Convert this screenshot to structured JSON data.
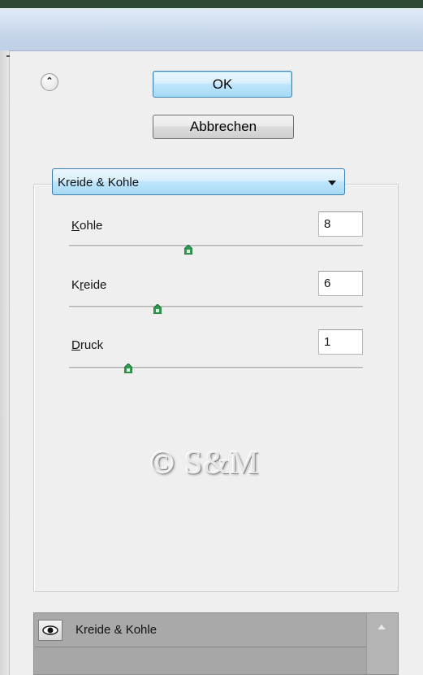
{
  "dialog": {
    "ok_label": "OK",
    "cancel_label": "Abbrechen",
    "collapse_icon": "double-chevron-up-icon"
  },
  "filter": {
    "selected": "Kreide & Kohle",
    "parameters": [
      {
        "label": "Kohle",
        "mnemonic": "K",
        "rest": "ohle",
        "value": "8",
        "slider_fraction": 0.4
      },
      {
        "label": "Kreide",
        "mnemonic": "r",
        "prefix": "K",
        "rest": "eide",
        "value": "6",
        "slider_fraction": 0.3
      },
      {
        "label": "Druck",
        "mnemonic": "D",
        "rest": "ruck",
        "value": "1",
        "slider_fraction": 0.2
      }
    ]
  },
  "watermark": "© S&M",
  "layers": {
    "items": [
      {
        "name": "Kreide & Kohle",
        "icon": "eye-icon"
      }
    ]
  },
  "colors": {
    "ok_button": "#bee6fd",
    "slider_thumb": "#2e9b4e",
    "panel_background": "#efefef",
    "layer_panel": "#a7a7a7"
  }
}
